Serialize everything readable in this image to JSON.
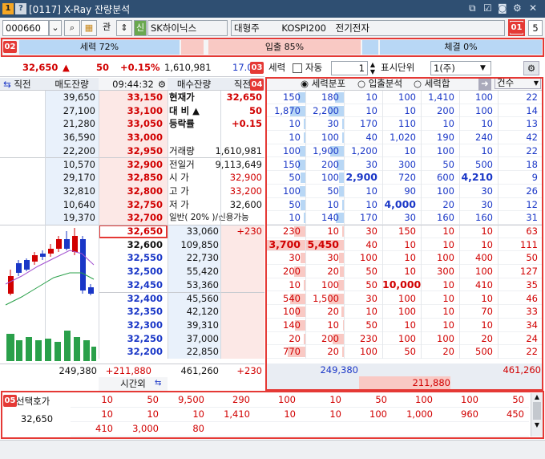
{
  "title": {
    "num1": "1",
    "num2": "?",
    "window": "[0117] X-Ray 잔량분석",
    "icons": [
      "link-icon",
      "memo-icon",
      "screenshot-icon",
      "settings-icon",
      "close-icon"
    ]
  },
  "toolbar": {
    "code": "000660",
    "gwan": "관",
    "sin": "신",
    "stock_name": "SK하이닉스",
    "type": "대형주",
    "index": "KOSPI200",
    "sector": "전기전자",
    "badge": "01",
    "count": "5"
  },
  "ratio": {
    "badge": "02",
    "force": "세력 72%",
    "inout": "입출 85%",
    "execution": "체결 0%"
  },
  "price_row": {
    "price": "32,650",
    "arrow": "▲",
    "change": "50",
    "pct": "+0.15%",
    "volume": "1,610,981",
    "partial": "17.0",
    "badge": "03"
  },
  "ctrl": {
    "force_label": "세력",
    "auto_label": "자동",
    "spin_value": "1",
    "unit_label": "표시단위",
    "unit_value": "1(주)"
  },
  "headers": {
    "prev_left": "직전",
    "sell_rem": "매도잔량",
    "time": "09:44:32",
    "buy_rem": "매수잔량",
    "prev_right": "직전",
    "badge": "04"
  },
  "radios": {
    "opt1": "세력분포",
    "opt2": "입출분석",
    "opt3": "세력합",
    "count_label": "건수"
  },
  "sell_rows": [
    {
      "rem": "39,650",
      "price": "33,150",
      "lbl": "현재가",
      "val": "32,650",
      "vals": [
        "150",
        "180",
        "10",
        "100",
        "1,410",
        "100",
        "22"
      ],
      "bars": [
        0.18,
        0.22
      ]
    },
    {
      "rem": "27,100",
      "price": "33,100",
      "lbl": "대  비 ▲",
      "val": "50",
      "vals": [
        "1,870",
        "2,200",
        "10",
        "10",
        "200",
        "100",
        "14"
      ],
      "bars": [
        0.4,
        0.4
      ]
    },
    {
      "rem": "21,280",
      "price": "33,050",
      "lbl": "등락률",
      "val": "+0.15",
      "vals": [
        "10",
        "30",
        "170",
        "110",
        "10",
        "10",
        "13"
      ],
      "bars": [
        0.05,
        0.05
      ]
    },
    {
      "rem": "36,590",
      "price": "33,000",
      "lbl": "",
      "val": "",
      "vals": [
        "10",
        "100",
        "40",
        "1,020",
        "190",
        "240",
        "42"
      ],
      "bars": [
        0.05,
        0.05
      ]
    },
    {
      "rem": "22,200",
      "price": "32,950",
      "lbl": "거래량",
      "val": "1,610,981",
      "vals": [
        "100",
        "1,900",
        "1,200",
        "10",
        "100",
        "10",
        "22"
      ],
      "bars": [
        0.15,
        0.35
      ]
    },
    {
      "rem": "10,570",
      "price": "32,900",
      "lbl": "전일거",
      "val": "9,113,649",
      "vals": [
        "150",
        "200",
        "30",
        "300",
        "50",
        "500",
        "18"
      ],
      "bars": [
        0.18,
        0.18
      ]
    },
    {
      "rem": "29,170",
      "price": "32,850",
      "lbl": "시  가",
      "val": "32,900",
      "vals": [
        "50",
        "100",
        "2,900",
        "720",
        "600",
        "4,210",
        "9"
      ],
      "bars": [
        0.12,
        0.12
      ]
    },
    {
      "rem": "32,810",
      "price": "32,800",
      "lbl": "고  가",
      "val": "33,200",
      "vals": [
        "100",
        "50",
        "10",
        "90",
        "100",
        "30",
        "26"
      ],
      "bars": [
        0.15,
        0.12
      ]
    },
    {
      "rem": "10,640",
      "price": "32,750",
      "lbl": "저  가",
      "val": "32,600",
      "vals": [
        "50",
        "10",
        "10",
        "4,000",
        "20",
        "30",
        "12"
      ],
      "bars": [
        0.12,
        0.05
      ]
    },
    {
      "rem": "19,370",
      "price": "32,700",
      "lbl": "일반( 20% )/신용가능",
      "val": "",
      "vals": [
        "10",
        "140",
        "170",
        "30",
        "160",
        "160",
        "31"
      ],
      "bars": [
        0.05,
        0.2
      ]
    }
  ],
  "buy_rows": [
    {
      "price": "32,650",
      "rem": "33,060",
      "prev": "+230",
      "vals": [
        "230",
        "10",
        "30",
        "150",
        "10",
        "10",
        "63"
      ],
      "bars": [
        0.3,
        0.05
      ]
    },
    {
      "price": "32,600",
      "rem": "109,850",
      "prev": "",
      "vals": [
        "3,700",
        "5,450",
        "40",
        "10",
        "10",
        "10",
        "111"
      ],
      "bars": [
        0.0,
        0.0
      ]
    },
    {
      "price": "32,550",
      "rem": "22,730",
      "prev": "",
      "vals": [
        "30",
        "30",
        "100",
        "10",
        "100",
        "400",
        "50"
      ],
      "bars": [
        0.12,
        0.12
      ]
    },
    {
      "price": "32,500",
      "rem": "55,420",
      "prev": "",
      "vals": [
        "200",
        "20",
        "50",
        "10",
        "300",
        "100",
        "127"
      ],
      "bars": [
        0.3,
        0.1
      ]
    },
    {
      "price": "32,450",
      "rem": "53,360",
      "prev": "",
      "vals": [
        "10",
        "100",
        "50",
        "10,000",
        "10",
        "410",
        "35"
      ],
      "bars": [
        0.05,
        0.15
      ]
    },
    {
      "price": "32,400",
      "rem": "45,560",
      "prev": "",
      "vals": [
        "540",
        "1,500",
        "30",
        "100",
        "10",
        "10",
        "46"
      ],
      "bars": [
        0.4,
        0.4
      ]
    },
    {
      "price": "32,350",
      "rem": "42,120",
      "prev": "",
      "vals": [
        "100",
        "20",
        "10",
        "100",
        "10",
        "70",
        "33"
      ],
      "bars": [
        0.25,
        0.06
      ]
    },
    {
      "price": "32,300",
      "rem": "39,310",
      "prev": "",
      "vals": [
        "140",
        "10",
        "50",
        "10",
        "10",
        "10",
        "34"
      ],
      "bars": [
        0.28,
        0.03
      ]
    },
    {
      "price": "32,250",
      "rem": "37,000",
      "prev": "",
      "vals": [
        "20",
        "200",
        "230",
        "100",
        "100",
        "20",
        "24"
      ],
      "bars": [
        0.05,
        0.3
      ]
    },
    {
      "price": "32,200",
      "rem": "22,850",
      "prev": "",
      "vals": [
        "770",
        "20",
        "100",
        "50",
        "20",
        "500",
        "22"
      ],
      "bars": [
        0.45,
        0.05
      ]
    }
  ],
  "totals": {
    "sell": "249,380",
    "sell_diff": "+211,880",
    "buy": "461,260",
    "buy_diff": "+230",
    "r_sell": "249,380",
    "r_buy": "461,260",
    "r_diff": "211,880",
    "after_hours": "시간외"
  },
  "bottom": {
    "badge": "05",
    "label": "선택호가",
    "price": "32,650",
    "row1": [
      "10",
      "50",
      "9,500",
      "290",
      "100",
      "10",
      "50",
      "100",
      "100",
      "50"
    ],
    "row2": [
      "10",
      "10",
      "10",
      "1,410",
      "10",
      "10",
      "100",
      "1,000",
      "960",
      "450"
    ],
    "row3": [
      "410",
      "3,000",
      "80"
    ]
  },
  "colors": {
    "accent": "#e53935",
    "up": "#d10000",
    "down": "#1a37c7"
  }
}
